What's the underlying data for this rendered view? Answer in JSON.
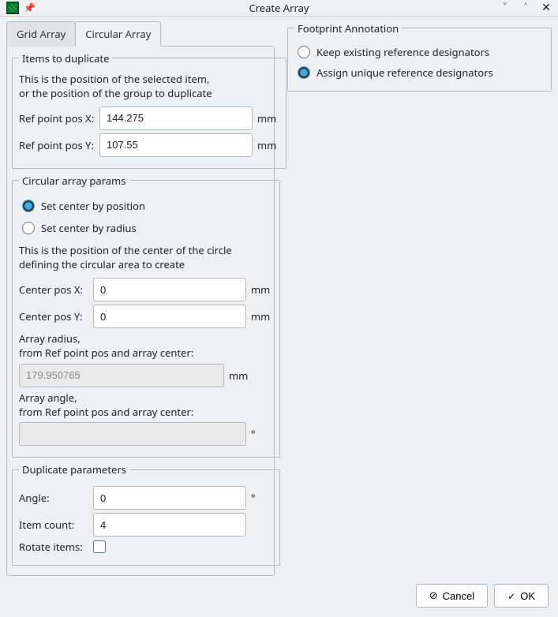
{
  "window": {
    "title": "Create Array"
  },
  "tabs": {
    "grid": "Grid Array",
    "circular": "Circular Array"
  },
  "items_fs": {
    "legend": "Items to duplicate",
    "desc1": "This is the position of the selected item,",
    "desc2": "or the position of the group to duplicate",
    "refx_label": "Ref point pos X:",
    "refx_value": "144.275",
    "refy_label": "Ref point pos Y:",
    "refy_value": "107.55",
    "unit": "mm"
  },
  "circular_fs": {
    "legend": "Circular array params",
    "radio_pos": "Set center by position",
    "radio_rad": "Set center by radius",
    "desc1": "This is the position of the center of the circle",
    "desc2": "defining the circular area to create",
    "cx_label": "Center pos X:",
    "cx_value": "0",
    "cy_label": "Center pos Y:",
    "cy_value": "0",
    "unit": "mm",
    "radius_label1": "Array radius,",
    "radius_label2": "from Ref point pos and array center:",
    "radius_value": "179.950765",
    "angle_label1": "Array angle,",
    "angle_label2": "from Ref point pos and array center:",
    "angle_value": "",
    "deg": "°"
  },
  "dup_fs": {
    "legend": "Duplicate parameters",
    "angle_label": "Angle:",
    "angle_value": "0",
    "deg": "°",
    "count_label": "Item count:",
    "count_value": "4",
    "rotate_label": "Rotate items:"
  },
  "annotation_fs": {
    "legend": "Footprint Annotation",
    "keep": "Keep existing reference designators",
    "assign": "Assign unique reference designators"
  },
  "footer": {
    "cancel": "Cancel",
    "ok": "OK"
  }
}
